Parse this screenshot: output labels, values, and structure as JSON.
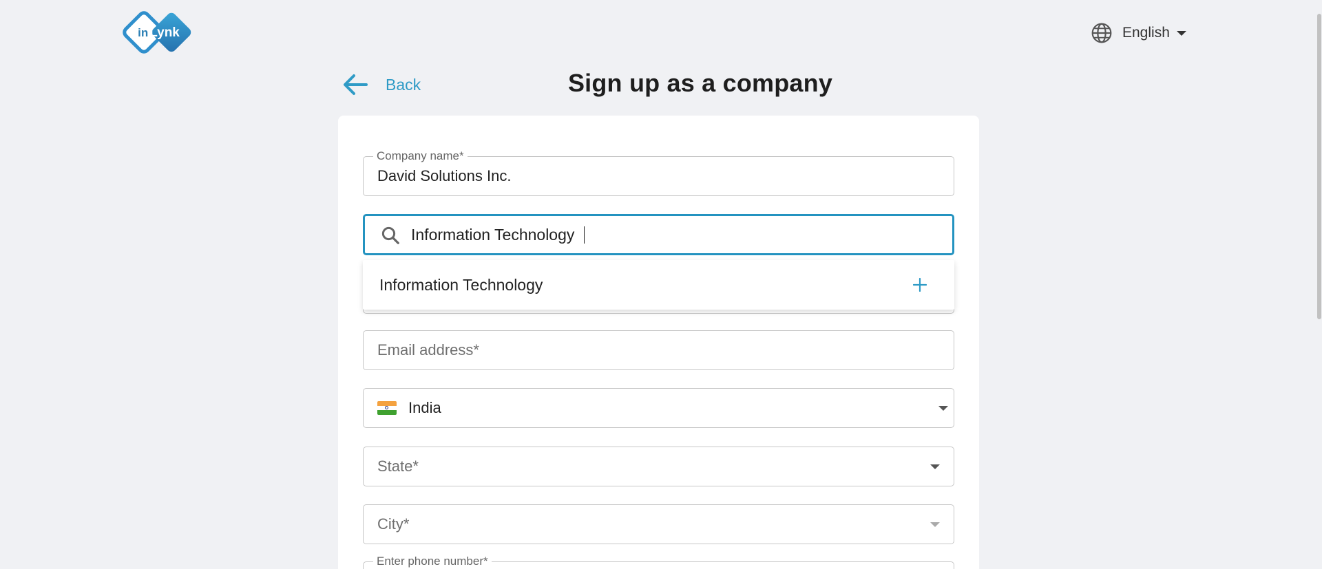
{
  "brand": {
    "logo_text_in": "in",
    "logo_text_lynk": "Lynk",
    "logo_icon": "inlynk-logo",
    "colors": {
      "primary": "#2f9bc6",
      "logo_dark": "#2b6fa8"
    }
  },
  "header": {
    "language": {
      "label": "English",
      "icon": "globe-icon"
    }
  },
  "nav": {
    "back_label": "Back",
    "back_icon": "arrow-left-icon"
  },
  "page": {
    "title": "Sign up as a company"
  },
  "form": {
    "company_name": {
      "label": "Company name*",
      "value": "David Solutions Inc."
    },
    "industry_search": {
      "value": "Information Technology",
      "icon": "search-icon"
    },
    "suggestion": {
      "label": "Information Technology",
      "icon": "plus-icon"
    },
    "email": {
      "placeholder": "Email address*"
    },
    "country": {
      "value": "India",
      "icon": "india-flag-icon"
    },
    "state": {
      "placeholder": "State*"
    },
    "city": {
      "placeholder": "City*"
    },
    "phone": {
      "label": "Enter phone number*"
    }
  }
}
